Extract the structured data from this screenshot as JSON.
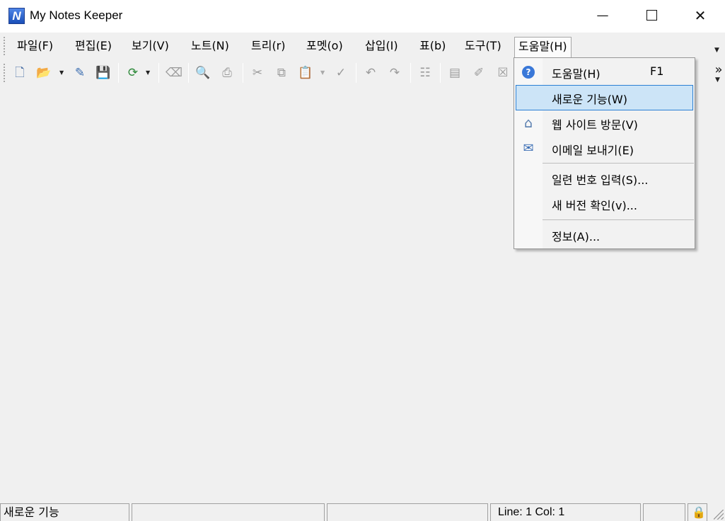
{
  "window": {
    "title": "My Notes Keeper",
    "app_icon_letter": "N"
  },
  "menubar": {
    "items": [
      {
        "label": "파일(F)",
        "name": "file"
      },
      {
        "label": "편집(E)",
        "name": "edit"
      },
      {
        "label": "보기(V)",
        "name": "view"
      },
      {
        "label": "노트(N)",
        "name": "note"
      },
      {
        "label": "트리(r)",
        "name": "tree"
      },
      {
        "label": "포멧(o)",
        "name": "format"
      },
      {
        "label": "삽입(I)",
        "name": "insert"
      },
      {
        "label": "표(b)",
        "name": "table"
      },
      {
        "label": "도구(T)",
        "name": "tools"
      },
      {
        "label": "도움말(H)",
        "name": "help",
        "open": true
      }
    ]
  },
  "toolbar": {
    "icons": [
      {
        "name": "new-note-icon",
        "glyph": "🗋"
      },
      {
        "name": "open-folder-icon",
        "glyph": "📂"
      },
      {
        "name": "eraser-icon",
        "glyph": "✎"
      },
      {
        "name": "save-icon",
        "glyph": "💾"
      },
      {
        "name": "refresh-icon",
        "glyph": "⟳"
      },
      {
        "name": "broom-icon",
        "glyph": "⌫"
      },
      {
        "name": "print-preview-icon",
        "glyph": "🔍"
      },
      {
        "name": "print-icon",
        "glyph": "⎙"
      },
      {
        "name": "cut-icon",
        "glyph": "✂"
      },
      {
        "name": "copy-icon",
        "glyph": "⧉"
      },
      {
        "name": "paste-icon",
        "glyph": "📋"
      },
      {
        "name": "spellcheck-icon",
        "glyph": "✓"
      },
      {
        "name": "undo-icon",
        "glyph": "↶"
      },
      {
        "name": "redo-icon",
        "glyph": "↷"
      },
      {
        "name": "tree-icon",
        "glyph": "☷"
      },
      {
        "name": "add-note-icon",
        "glyph": "▤"
      },
      {
        "name": "edit-note-icon",
        "glyph": "✐"
      },
      {
        "name": "delete-note-icon",
        "glyph": "☒"
      }
    ],
    "overflow_glyph": "»"
  },
  "help_menu": {
    "items": [
      {
        "label": "도움말(H)",
        "shortcut": "F1",
        "icon": "help-circle-icon",
        "icon_glyph": "?"
      },
      {
        "label": "새로운 기능(W)",
        "shortcut": "",
        "icon": "",
        "icon_glyph": "",
        "highlighted": true
      },
      {
        "label": "웹 사이트 방문(V)",
        "shortcut": "",
        "icon": "home-icon",
        "icon_glyph": "⌂"
      },
      {
        "label": "이메일 보내기(E)",
        "shortcut": "",
        "icon": "envelope-icon",
        "icon_glyph": "✉"
      },
      {
        "label": "일련 번호 입력(S)...",
        "shortcut": "",
        "icon": "",
        "icon_glyph": ""
      },
      {
        "label": "새 버전 확인(v)...",
        "shortcut": "",
        "icon": "",
        "icon_glyph": ""
      },
      {
        "label": "정보(A)...",
        "shortcut": "",
        "icon": "",
        "icon_glyph": ""
      }
    ]
  },
  "statusbar": {
    "message": "새로운 기능",
    "position": "Line: 1   Col: 1",
    "lock_glyph": "🔒"
  },
  "colors": {
    "highlight_bg": "#cce4f7",
    "highlight_border": "#2a7fd4",
    "help_icon_blue": "#3a78d8"
  }
}
